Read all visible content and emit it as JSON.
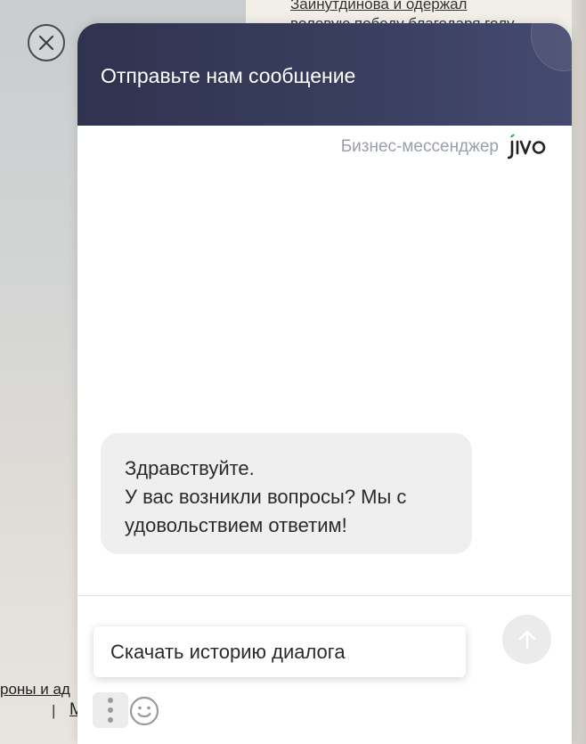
{
  "background_page": {
    "text_line_1": "Зайнутдинова и одержал",
    "text_line_2": "волевую победу благодаря голу",
    "bottom_link": "роны и ад",
    "separator": "|",
    "bottom_link_2": "М"
  },
  "chat": {
    "title": "Отправьте нам сообщение",
    "brand_label": "Бизнес-мессенджер",
    "brand_name": "jivo",
    "greeting": {
      "line1": "Здравствуйте.",
      "line2": "У вас возникли вопросы? Мы с",
      "line3": "удовольствием ответим!"
    },
    "menu": {
      "download_history": "Скачать историю диалога"
    }
  },
  "icons": {
    "close": "close-icon",
    "send": "arrow-up-icon",
    "more": "more-vertical-icon",
    "emoji": "smile-icon"
  },
  "colors": {
    "header_start": "#30334f",
    "header_end": "#454b70",
    "brand_green": "#3bb34a",
    "bubble_bg": "#efefef"
  }
}
